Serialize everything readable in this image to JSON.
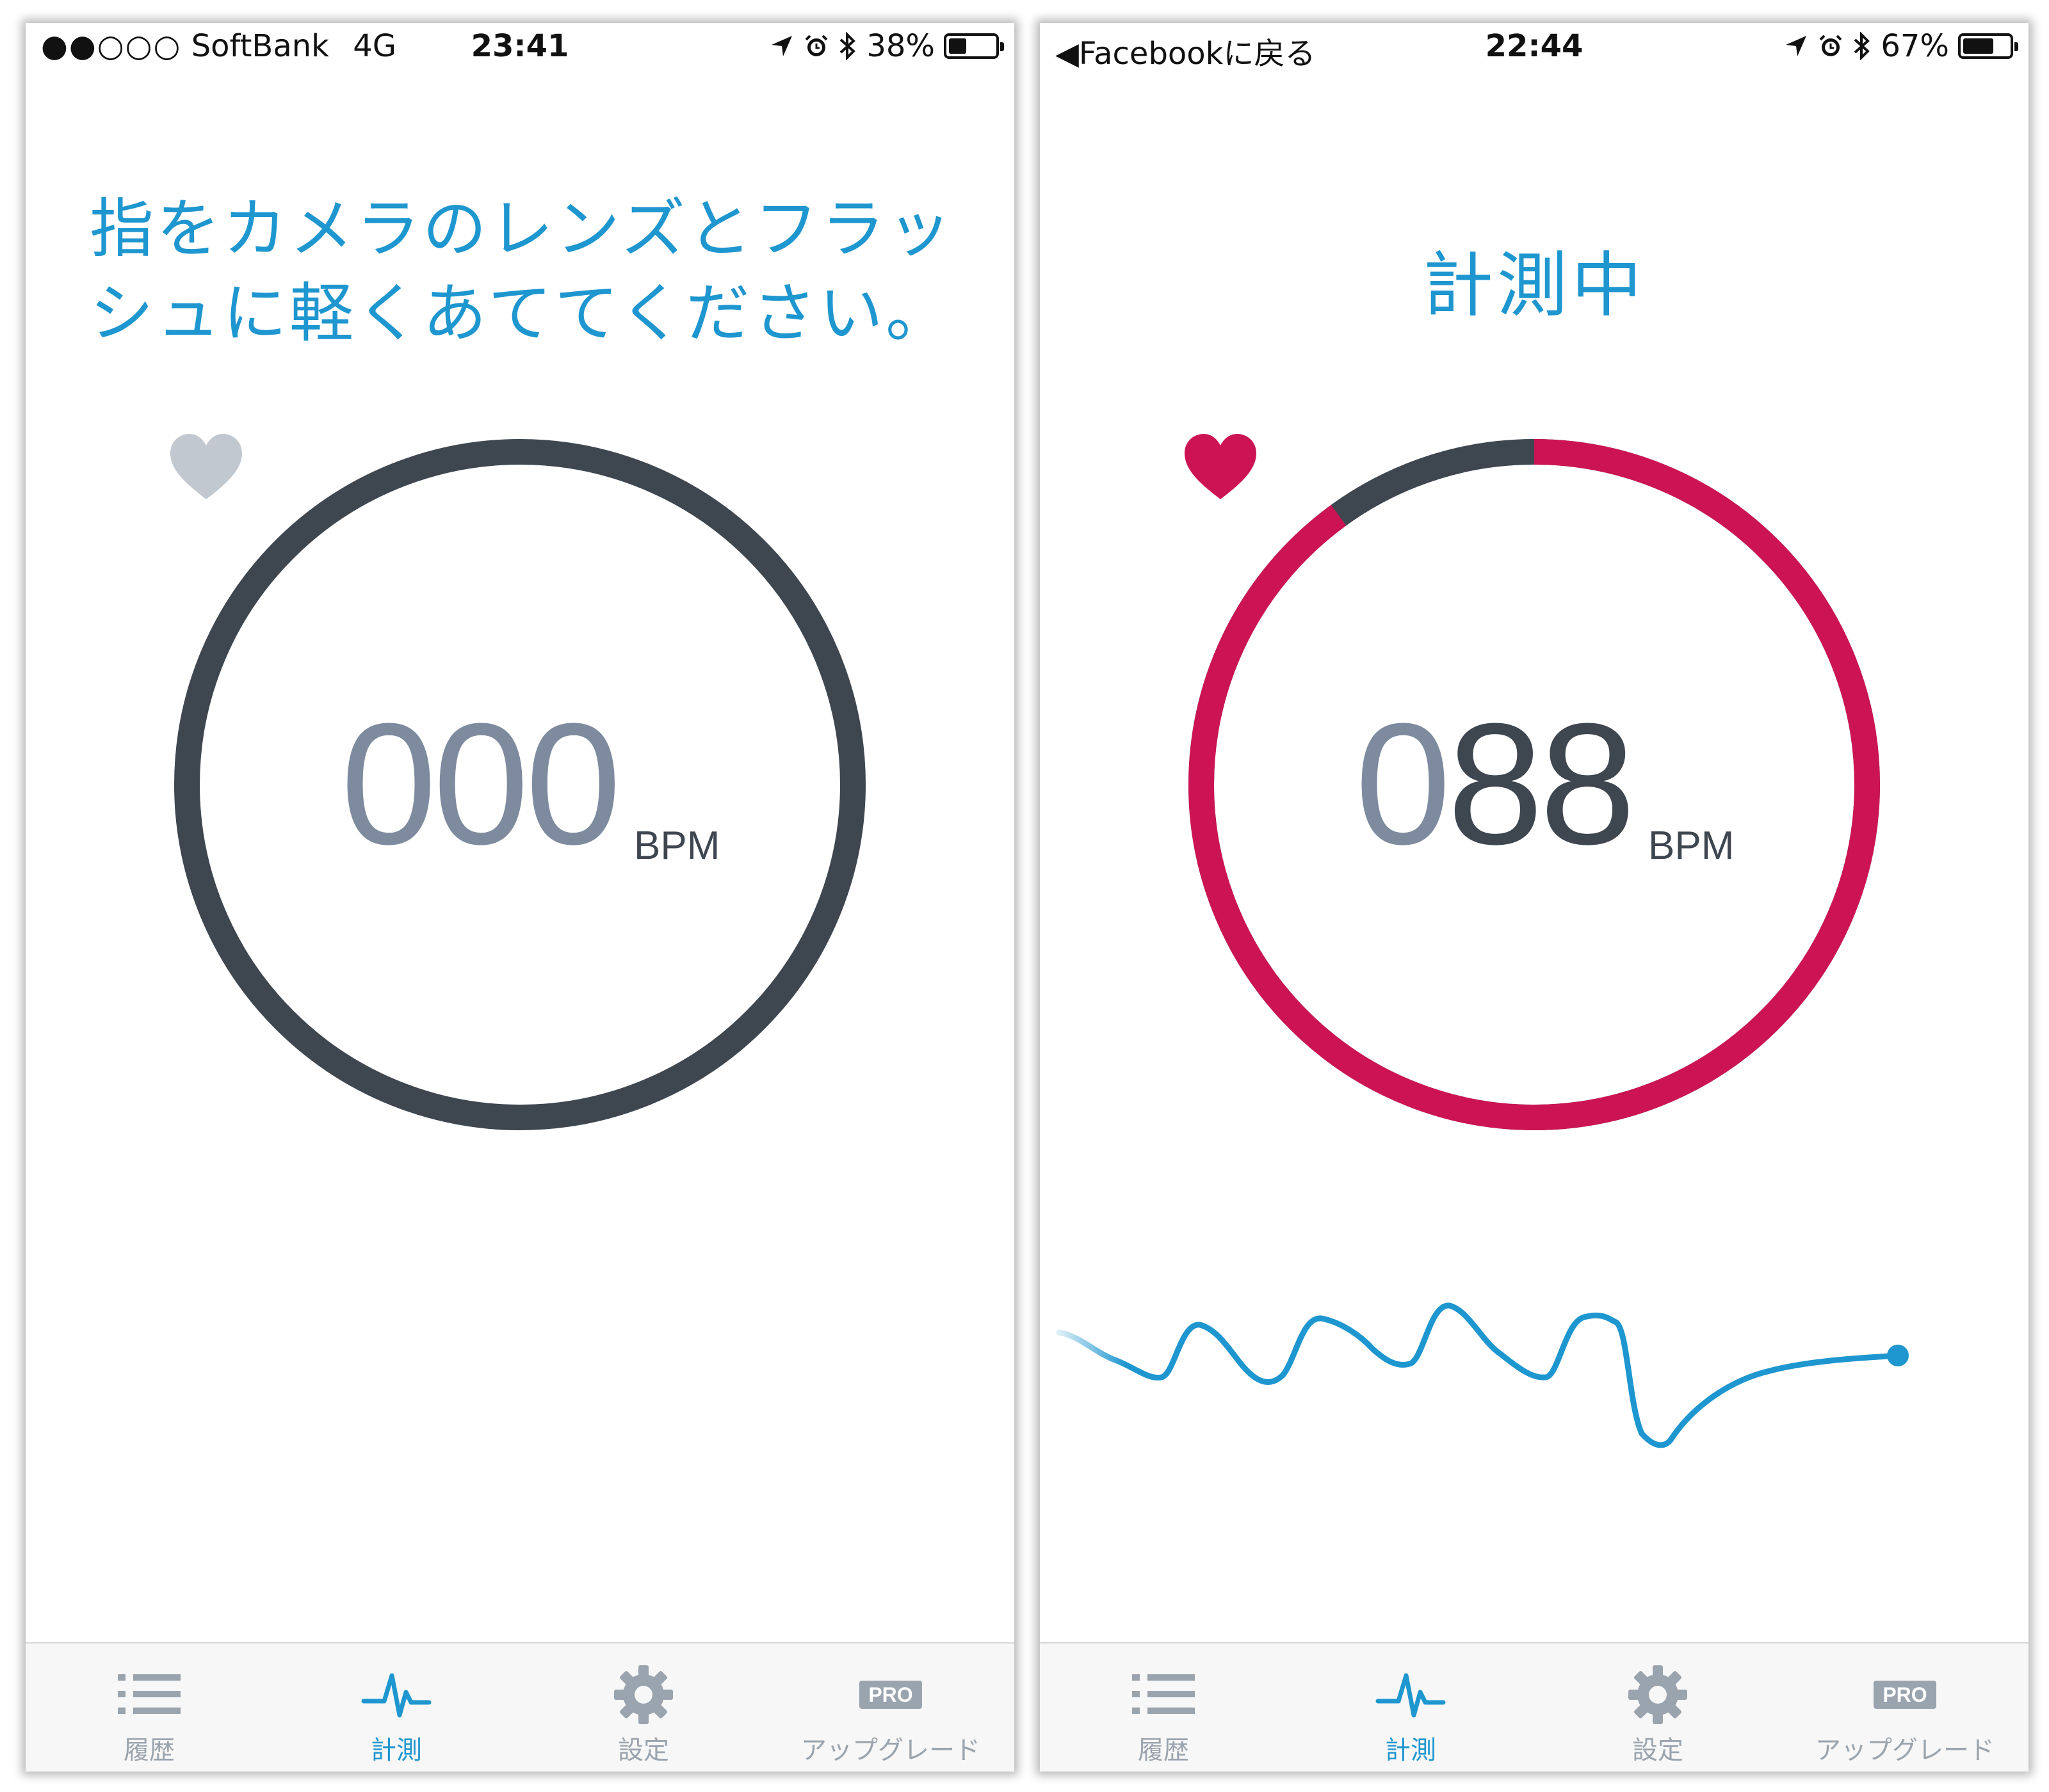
{
  "colors": {
    "accent": "#1e96cf",
    "ring_dark": "#3e4650",
    "ring_active": "#cc1454",
    "heart_idle": "#c2c8cf",
    "tab_inactive": "#9aa4ae"
  },
  "screens": [
    {
      "status_bar": {
        "signal": "●●○○○",
        "carrier": "SoftBank",
        "network": "4G",
        "time": "23:41",
        "battery_text": "38%",
        "battery_level": 0.38
      },
      "instruction_text": "指をカメラのレンズとフラッシュに軽くあててください。",
      "bpm": {
        "digits_muted": "000",
        "digits_active": "",
        "unit": "BPM"
      },
      "progress": 0,
      "tabs": [
        {
          "label": "履歴",
          "icon": "list-icon"
        },
        {
          "label": "計測",
          "icon": "pulse-icon",
          "active": true
        },
        {
          "label": "設定",
          "icon": "gear-icon"
        },
        {
          "label": "アップグレード",
          "icon": "pro-badge-icon",
          "badge": "PRO"
        }
      ]
    },
    {
      "status_bar": {
        "back_label": "◀Facebookに戻る",
        "time": "22:44",
        "battery_text": "67%",
        "battery_level": 0.67
      },
      "title": "計測中",
      "bpm": {
        "digits_muted": "0",
        "digits_active": "88",
        "unit": "BPM"
      },
      "progress": 0.9,
      "tabs": [
        {
          "label": "履歴",
          "icon": "list-icon"
        },
        {
          "label": "計測",
          "icon": "pulse-icon",
          "active": true
        },
        {
          "label": "設定",
          "icon": "gear-icon"
        },
        {
          "label": "アップグレード",
          "icon": "pro-badge-icon",
          "badge": "PRO"
        }
      ]
    }
  ]
}
